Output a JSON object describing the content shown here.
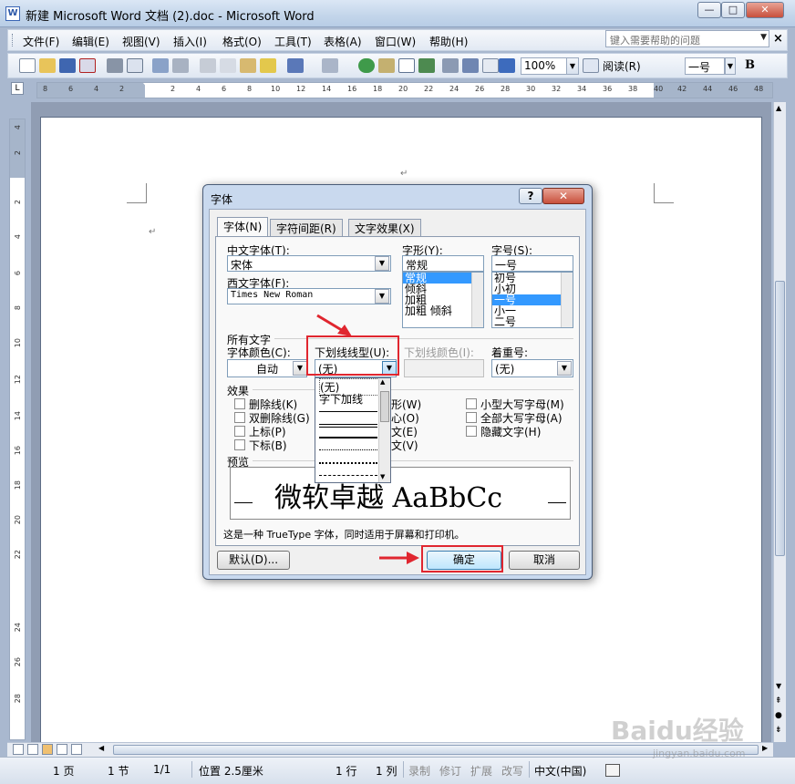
{
  "window": {
    "title": "新建 Microsoft Word 文档 (2).doc - Microsoft Word",
    "app_icon": "W",
    "controls": {
      "minimize": "—",
      "maximize": "□",
      "close": "✕"
    }
  },
  "menubar": {
    "items": [
      "文件(F)",
      "编辑(E)",
      "视图(V)",
      "插入(I)",
      "格式(O)",
      "工具(T)",
      "表格(A)",
      "窗口(W)",
      "帮助(H)"
    ],
    "help_placeholder": "键入需要帮助的问题",
    "close": "×"
  },
  "toolbar": {
    "zoom": "100%",
    "read_label": "阅读(R)",
    "font_size": "一号",
    "bold": "B"
  },
  "ruler": {
    "left_numbers": [
      "8",
      "6",
      "4",
      "2"
    ],
    "right_numbers": [
      "2",
      "4",
      "6",
      "8",
      "10",
      "12",
      "14",
      "16",
      "18",
      "20",
      "22",
      "24",
      "26",
      "28",
      "30",
      "32",
      "34",
      "36",
      "38",
      "40",
      "42",
      "44",
      "46",
      "48"
    ],
    "vertical_numbers": [
      "4",
      "2",
      "2",
      "4",
      "6",
      "8",
      "10",
      "12",
      "14",
      "16",
      "18",
      "20",
      "22",
      "24",
      "26",
      "28"
    ]
  },
  "dialog": {
    "title": "字体",
    "help": "?",
    "close": "✕",
    "tabs": [
      "字体(N)",
      "字符间距(R)",
      "文字效果(X)"
    ],
    "chinese_font_label": "中文字体(T):",
    "chinese_font_value": "宋体",
    "western_font_label": "西文字体(F):",
    "western_font_value": "Times New Roman",
    "style_label": "字形(Y):",
    "style_value": "常规",
    "style_options": [
      "常规",
      "倾斜",
      "加粗",
      "加粗 倾斜"
    ],
    "size_label": "字号(S):",
    "size_value": "一号",
    "size_options": [
      "初号",
      "小初",
      "一号",
      "小一",
      "二号"
    ],
    "all_text_label": "所有文字",
    "font_color_label": "字体颜色(C):",
    "font_color_value": "自动",
    "underline_style_label": "下划线线型(U):",
    "underline_style_value": "(无)",
    "underline_color_label": "下划线颜色(I):",
    "emphasis_label": "着重号:",
    "emphasis_value": "(无)",
    "underline_options": [
      "(无)",
      "字下加线"
    ],
    "effects_label": "效果",
    "effects_left": [
      "删除线(K)",
      "双删除线(G)",
      "上标(P)",
      "下标(B)"
    ],
    "effects_mid_keys": [
      "(W)",
      "(O)",
      "(E)",
      "(V)"
    ],
    "effects_mid_prefix": [
      "",
      "",
      "",
      ""
    ],
    "effects_mid_visible": [
      "形(W)",
      "心(O)",
      "文(E)",
      "文(V)"
    ],
    "effects_right": [
      "小型大写字母(M)",
      "全部大写字母(A)",
      "隐藏文字(H)"
    ],
    "preview_label": "预览",
    "preview_text": "微软卓越  AaBbCc",
    "truetype_note": "这是一种 TrueType 字体，同时适用于屏幕和打印机。",
    "default_button": "默认(D)...",
    "ok_button": "确定",
    "cancel_button": "取消"
  },
  "statusbar": {
    "page": "1 页",
    "section": "1 节",
    "pages": "1/1",
    "position": "位置 2.5厘米",
    "line": "1 行",
    "column": "1 列",
    "modes": [
      "录制",
      "修订",
      "扩展",
      "改写"
    ],
    "language": "中文(中国)"
  },
  "watermark": {
    "main": "Baidu经验",
    "sub": "jingyan.baidu.com"
  },
  "colors": {
    "highlight": "#e0262f",
    "selection": "#3399ff",
    "titlebar": "#c3d5ea"
  }
}
